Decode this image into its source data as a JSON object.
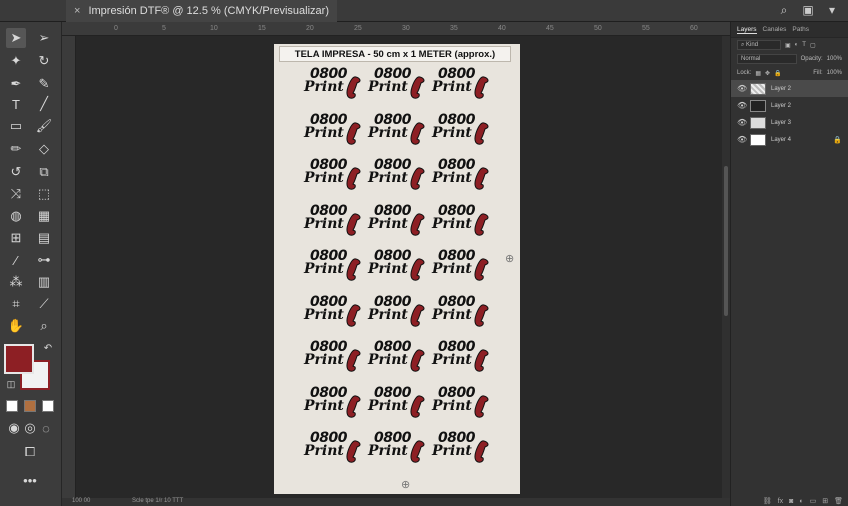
{
  "document_tab": {
    "title": "Impresión DTF® @ 12.5 % (CMYK/Previsualizar)",
    "close_glyph": "×"
  },
  "top_icons": [
    "search-icon",
    "window-icon",
    "view-icon"
  ],
  "ruler": {
    "h_ticks": [
      "0",
      "5",
      "10",
      "15",
      "20",
      "25",
      "30",
      "35",
      "40",
      "45",
      "50",
      "55",
      "60"
    ]
  },
  "document": {
    "header": "TELA IMPRESA - 50 cm x 1 METER (approx.)",
    "logo": {
      "line1": "0800",
      "line2": "Print"
    },
    "rows": 9,
    "columns": 3,
    "colors": {
      "fabric": "#e8e4dd",
      "logo_text": "#111111",
      "phone": "#8d1f24"
    }
  },
  "toolbar": {
    "foreground_color": "#8d1f24",
    "background_color": "#f2f2f2"
  },
  "status": {
    "zoom": "100 00",
    "info": "Scle tpe 1/r 10 TTT"
  },
  "layers_panel": {
    "tabs": [
      "Layers",
      "Canales",
      "Paths"
    ],
    "active_tab": "Layers",
    "filter_label": "Kind",
    "blend_mode": "Normal",
    "opacity_label": "Opacity:",
    "opacity_value": "100%",
    "lock_label": "Lock:",
    "fill_label": "Fill:",
    "fill_value": "100%",
    "layers": [
      {
        "name": "Layer 2",
        "selected": true,
        "locked": false
      },
      {
        "name": "Layer 2",
        "selected": false,
        "locked": false
      },
      {
        "name": "Layer 3",
        "selected": false,
        "locked": false
      },
      {
        "name": "Layer 4",
        "selected": false,
        "locked": true
      }
    ]
  }
}
